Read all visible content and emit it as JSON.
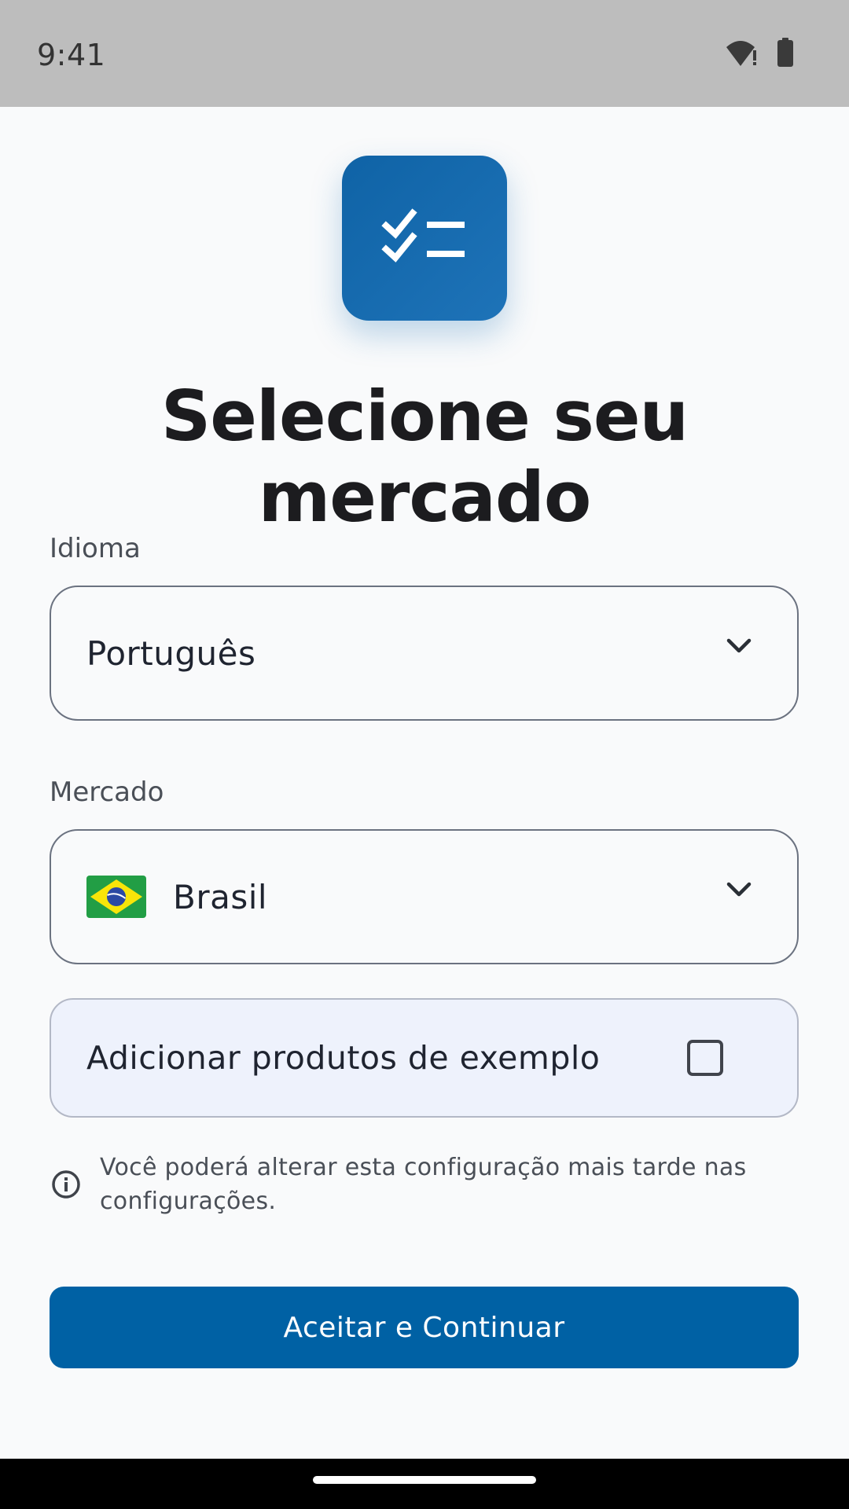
{
  "status_bar": {
    "time": "9:41",
    "icons": [
      "wifi-alert-icon",
      "battery-icon"
    ]
  },
  "app_icon": {
    "icon": "checklist-icon",
    "background": "#1766ac"
  },
  "page_title": "Selecione seu mercado",
  "language_field": {
    "label": "Idioma",
    "value": "Português",
    "icon": "chevron-down-icon"
  },
  "market_field": {
    "label": "Mercado",
    "value": "Brasil",
    "flag": "brazil-flag-icon",
    "icon": "chevron-down-icon"
  },
  "sample_products": {
    "label": "Adicionar produtos de exemplo",
    "checked": false
  },
  "info_note": {
    "icon": "info-icon",
    "text": "Você poderá alterar esta configuração mais tarde nas configurações."
  },
  "primary_button": {
    "label": "Aceitar e Continuar",
    "color": "#0061a4"
  }
}
